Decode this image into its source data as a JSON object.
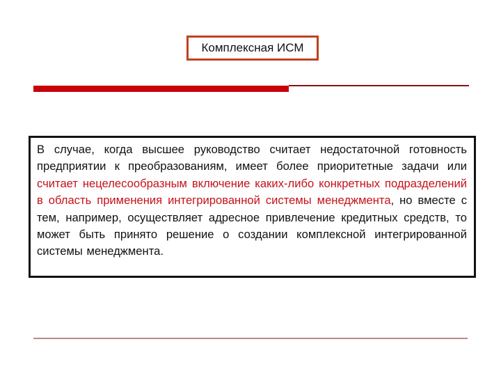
{
  "title": "Комплексная ИСМ",
  "colors": {
    "title_border": "#c0411e",
    "accent_red": "#c8040a",
    "highlight_text": "#c4121a",
    "bottom_rule": "#b98a8a"
  },
  "body": {
    "segments": [
      {
        "text": "В случае, когда высшее руководство считает недостаточной готовность предприятии к преобразованиям, имеет более приоритетные задачи или ",
        "highlight": false
      },
      {
        "text": "считает нецелесообразным включение каких-либо конкретных подразделений в область применения интегрированной системы менеджмента",
        "highlight": true
      },
      {
        "text": ", но вместе с тем, например, осуществляет адресное привлечение кредитных средств, то может быть принято решение о создании комплексной интегрированной системы менеджмента.",
        "highlight": false
      }
    ]
  }
}
